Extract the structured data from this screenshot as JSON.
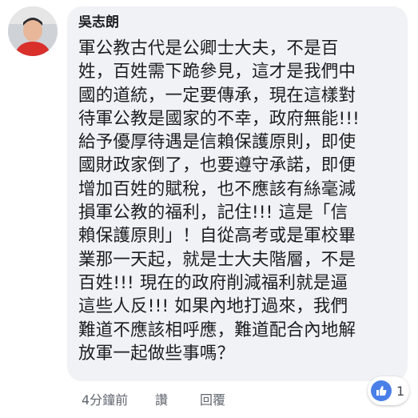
{
  "comment": {
    "author": "吳志朗",
    "text": "軍公教古代是公卿士大夫，不是百\n姓，百姓需下跪參見，這才是我們中\n國的道統，一定要傳承，現在這樣對\n待軍公教是國家的不幸，政府無能!!!\n給予優厚待遇是信賴保護原則，即使\n國財政家倒了，也要遵守承諾，即便\n增加百姓的賦稅，也不應該有絲毫減\n損軍公教的福利，記住!!! 這是「信\n賴保護原則」！自從高考或是軍校畢\n業那一天起，就是士大夫階層，不是\n百姓!!! 現在的政府削減福利就是逼\n這些人反!!! 如果內地打過來，我們\n難道不應該相呼應，難道配合內地解\n放軍一起做些事嗎？"
  },
  "meta": {
    "time": "4分鐘前",
    "like_label": "讚",
    "reply_label": "回覆"
  },
  "reaction": {
    "icon": "thumbs-up-icon",
    "count": "1",
    "color": "#4a7fe8"
  }
}
